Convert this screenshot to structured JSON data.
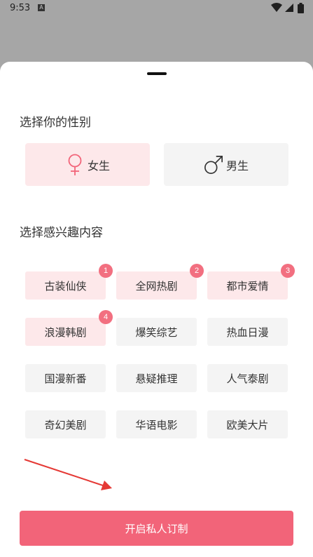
{
  "status_bar": {
    "time": "9:53",
    "notification_icon": "A",
    "icons": [
      "wifi-icon",
      "signal-icon",
      "battery-icon"
    ]
  },
  "gender_section": {
    "title": "选择你的性别",
    "options": [
      {
        "label": "女生",
        "icon": "female-icon",
        "selected": true
      },
      {
        "label": "男生",
        "icon": "male-icon",
        "selected": false
      }
    ]
  },
  "interest_section": {
    "title": "选择感兴趣内容",
    "tags": [
      {
        "label": "古装仙侠",
        "selected": true,
        "badge": "1"
      },
      {
        "label": "全网热剧",
        "selected": true,
        "badge": "2"
      },
      {
        "label": "都市爱情",
        "selected": true,
        "badge": "3"
      },
      {
        "label": "浪漫韩剧",
        "selected": true,
        "badge": "4"
      },
      {
        "label": "爆笑综艺",
        "selected": false,
        "badge": ""
      },
      {
        "label": "热血日漫",
        "selected": false,
        "badge": ""
      },
      {
        "label": "国漫新番",
        "selected": false,
        "badge": ""
      },
      {
        "label": "悬疑推理",
        "selected": false,
        "badge": ""
      },
      {
        "label": "人气泰剧",
        "selected": false,
        "badge": ""
      },
      {
        "label": "奇幻美剧",
        "selected": false,
        "badge": ""
      },
      {
        "label": "华语电影",
        "selected": false,
        "badge": ""
      },
      {
        "label": "欧美大片",
        "selected": false,
        "badge": ""
      }
    ]
  },
  "submit": {
    "label": "开启私人订制"
  },
  "colors": {
    "accent": "#f26479",
    "badge": "#f26f80",
    "selected_bg": "#fde8ea",
    "unselected_bg": "#f4f4f4",
    "arrow": "#e53935"
  }
}
